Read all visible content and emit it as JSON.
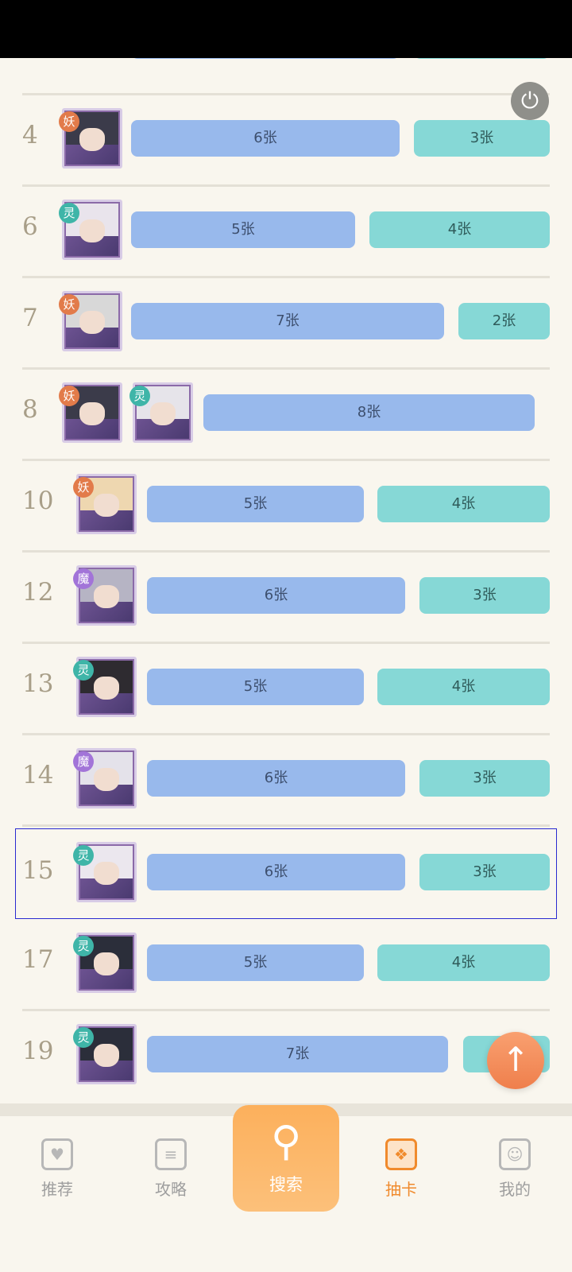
{
  "rows": [
    {
      "num": "",
      "bars": [
        {
          "label": "",
          "type": "blue"
        },
        {
          "label": "",
          "type": "teal"
        }
      ]
    },
    {
      "num": "4",
      "avatars": [
        {
          "badge": "妖",
          "badge_type": "yao",
          "tone": "#3b3b4a"
        }
      ],
      "bars": [
        {
          "label": "6张",
          "type": "blue"
        },
        {
          "label": "3张",
          "type": "teal"
        }
      ]
    },
    {
      "num": "6",
      "avatars": [
        {
          "badge": "灵",
          "badge_type": "ling",
          "tone": "#e9e4ec"
        }
      ],
      "bars": [
        {
          "label": "5张",
          "type": "blue"
        },
        {
          "label": "4张",
          "type": "teal"
        }
      ]
    },
    {
      "num": "7",
      "avatars": [
        {
          "badge": "妖",
          "badge_type": "yao",
          "tone": "#d8d8d8"
        }
      ],
      "bars": [
        {
          "label": "7张",
          "type": "blue"
        },
        {
          "label": "2张",
          "type": "teal"
        }
      ]
    },
    {
      "num": "8",
      "avatars": [
        {
          "badge": "妖",
          "badge_type": "yao",
          "tone": "#3b3b4a"
        },
        {
          "badge": "灵",
          "badge_type": "ling",
          "tone": "#e6e4ea"
        }
      ],
      "bars": [
        {
          "label": "8张",
          "type": "blue"
        }
      ]
    },
    {
      "num": "10",
      "avatars": [
        {
          "badge": "妖",
          "badge_type": "yao",
          "tone": "#eed7b0"
        }
      ],
      "bars": [
        {
          "label": "5张",
          "type": "blue"
        },
        {
          "label": "4张",
          "type": "teal"
        }
      ]
    },
    {
      "num": "12",
      "avatars": [
        {
          "badge": "魔",
          "badge_type": "mo",
          "tone": "#b6b4c4"
        }
      ],
      "bars": [
        {
          "label": "6张",
          "type": "blue"
        },
        {
          "label": "3张",
          "type": "teal"
        }
      ]
    },
    {
      "num": "13",
      "avatars": [
        {
          "badge": "灵",
          "badge_type": "ling",
          "tone": "#2e2b30"
        }
      ],
      "bars": [
        {
          "label": "5张",
          "type": "blue"
        },
        {
          "label": "4张",
          "type": "teal"
        }
      ]
    },
    {
      "num": "14",
      "avatars": [
        {
          "badge": "魔",
          "badge_type": "mo",
          "tone": "#e4e2ea"
        }
      ],
      "bars": [
        {
          "label": "6张",
          "type": "blue"
        },
        {
          "label": "3张",
          "type": "teal"
        }
      ]
    },
    {
      "num": "15",
      "avatars": [
        {
          "badge": "灵",
          "badge_type": "ling",
          "tone": "#ebe7ee"
        }
      ],
      "bars": [
        {
          "label": "6张",
          "type": "blue"
        },
        {
          "label": "3张",
          "type": "teal"
        }
      ]
    },
    {
      "num": "17",
      "avatars": [
        {
          "badge": "灵",
          "badge_type": "ling",
          "tone": "#2b2e3a"
        }
      ],
      "bars": [
        {
          "label": "5张",
          "type": "blue"
        },
        {
          "label": "4张",
          "type": "teal"
        }
      ]
    },
    {
      "num": "19",
      "avatars": [
        {
          "badge": "灵",
          "badge_type": "ling",
          "tone": "#2b2e3a"
        }
      ],
      "bars": [
        {
          "label": "7张",
          "type": "blue"
        },
        {
          "label": "",
          "type": "teal"
        }
      ]
    }
  ],
  "tabs": {
    "recommend": "推荐",
    "guide": "攻略",
    "search": "搜索",
    "draw": "抽卡",
    "mine": "我的"
  },
  "icons": {
    "power": "power-icon",
    "scroll_top": "arrow-up-icon",
    "search": "search-icon"
  },
  "colors": {
    "accent": "#f08a2c",
    "bar_blue": "#98b9ec",
    "bar_teal": "#86d8d6"
  }
}
